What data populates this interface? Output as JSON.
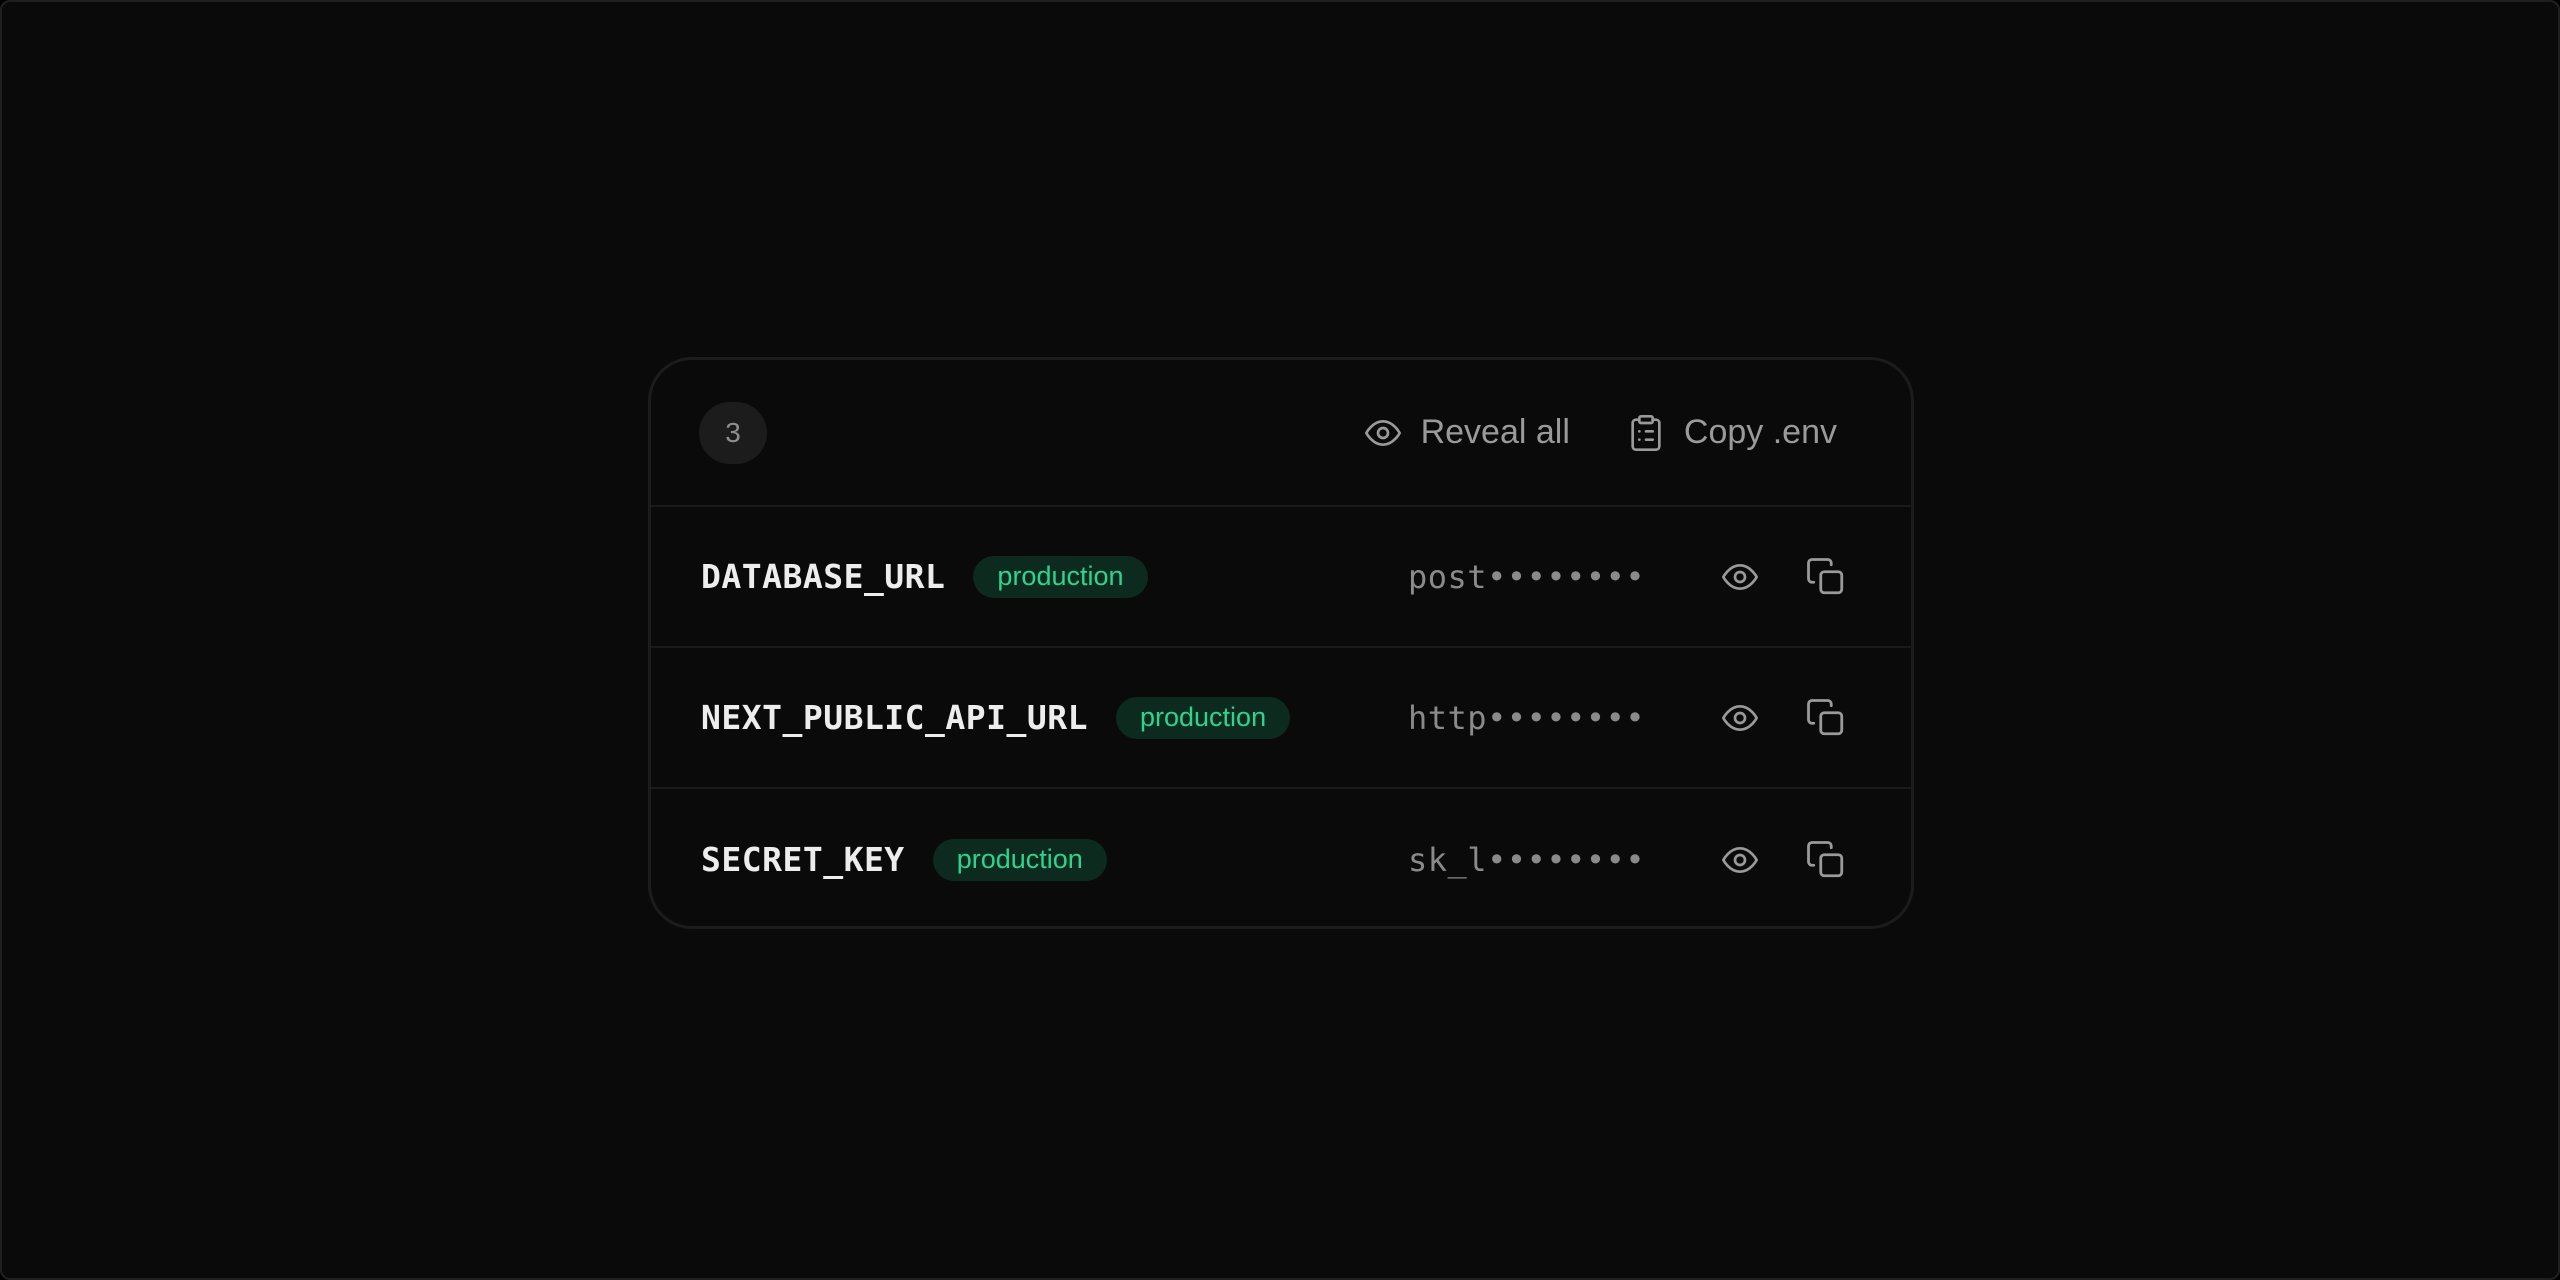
{
  "header": {
    "count": "3",
    "reveal_all_label": "Reveal all",
    "copy_env_label": "Copy .env",
    "icons": [
      "eye-icon",
      "clipboard-list-icon"
    ]
  },
  "variables": [
    {
      "name": "DATABASE_URL",
      "environment": "production",
      "masked_value": "post••••••••"
    },
    {
      "name": "NEXT_PUBLIC_API_URL",
      "environment": "production",
      "masked_value": "http••••••••"
    },
    {
      "name": "SECRET_KEY",
      "environment": "production",
      "masked_value": "sk_l••••••••"
    }
  ],
  "row_icons": [
    "eye-icon",
    "copy-icon"
  ],
  "colors": {
    "background": "#0a0a0a",
    "badge_text": "#2dd48f",
    "badge_bg": "#0c2a1e",
    "muted_text": "#9a9a9a"
  }
}
